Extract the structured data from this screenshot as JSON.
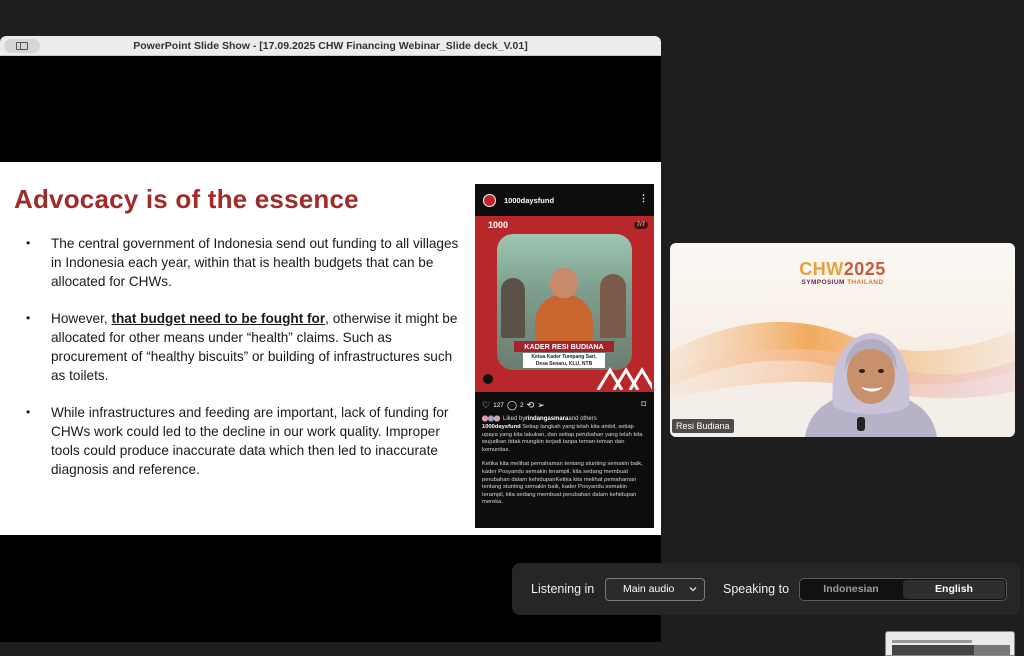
{
  "window": {
    "title": "PowerPoint Slide Show - [17.09.2025 CHW Financing Webinar_Slide deck_V.01]"
  },
  "slide": {
    "title": "Advocacy is of the essence",
    "bullets": [
      {
        "text": "The central government of Indonesia send out funding to all villages in Indonesia each year, within that is health budgets that can be allocated for CHWs."
      },
      {
        "pre": "However, ",
        "underlined": "that budget need to be fought for",
        "post": ", otherwise it might be allocated for other means under “health” claims. Such as procurement of “healthy biscuits” or building of infrastructures such as toilets."
      },
      {
        "text": "While infrastructures and feeding are important, lack of funding for CHWs work could led to the decline in our work quality. Improper tools could produce inaccurate data which then led to inaccurate diagnosis and reference."
      }
    ]
  },
  "instagram": {
    "username": "1000daysfund",
    "logo_text": "1000",
    "slide_count": "7/7",
    "banner_title": "KADER RESI BUDIANA",
    "banner_subtitle_1": "Ketua Kader Tumpang Sari,",
    "banner_subtitle_2": "Desa Senaru, KLU, NTB",
    "likes": "127",
    "comments": "2",
    "liked_prefix": "Liked by ",
    "liked_user": "rindangasmara",
    "liked_suffix": " and others",
    "caption_user": "1000daysfund",
    "caption_1": " Setiap langkah yang telah kita ambil, setiap upaya yang kita lakukan, dan setiap perubahan yang telah kita wujudkan tidak mungkin terjadi tanpa teman-teman dan komunitas.",
    "caption_2": "Ketika kita melihat pemahaman tentang stunting semakin baik, kader Posyandu semakin terampil, kita sedang membuat perubahan dalam kehidupanKetika kita melihat pemahaman tentang stunting semakin baik, kader Posyandu semakin terampil, kita sedang membuat perubahan dalam kehidupan mereka."
  },
  "video": {
    "brand_main": "CHW",
    "brand_year": "2025",
    "brand_sub": "SYMPOSIUM",
    "brand_country": "THAILAND",
    "participant_name": "Resi Budiana"
  },
  "audio": {
    "listening_label": "Listening in",
    "listening_value": "Main audio",
    "speaking_label": "Speaking to",
    "languages": [
      "Indonesian",
      "English"
    ],
    "active_language": "English"
  },
  "colors": {
    "slide_title": "#a12a2a",
    "ig_post": "#b8282b",
    "brand_orange": "#e8a13a"
  }
}
